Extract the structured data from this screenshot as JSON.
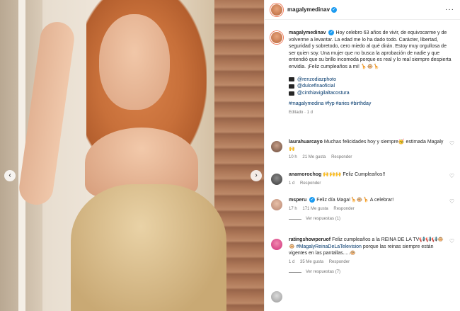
{
  "post": {
    "username": "magalymedinav",
    "caption": "Hoy celebro 63 años de vivir, de equivocarme y de volverme a levantar. La edad me lo ha dado todo. Carácter, libertad, seguridad y sobretodo, cero miedo al qué dirán. Estoy muy orgullosa de ser quien soy. Una mujer que no busca la aprobación de nadie y que entendió que su brillo incomoda porque es real y lo real siempre despierta envidia. ¡Feliz cumpleaños a mi! 🦒🐵🦒",
    "credits": [
      "@renzodiazphoto",
      "@dulcefinaoficial",
      "@cinthiavigilaltacostura"
    ],
    "hashtags": "#magalymedina #fyp #aries #birthday",
    "edited": "Editado · 1 d"
  },
  "comments": [
    {
      "username": "laurahuarcayo",
      "text": "Muchas felicidades hoy y siempre🥳 estimada Magaly🙌",
      "time": "10 h",
      "likes": "21 Me gusta",
      "reply": "Responder"
    },
    {
      "username": "anamorochog",
      "text": "🙌🙌🙌 Feliz Cumpleaños!!",
      "time": "1 d",
      "reply": "Responder"
    },
    {
      "username": "msperu",
      "text": "Feliz día Maga!🦒🐵🦒 A celebrar!",
      "time": "17 h",
      "likes": "171 Me gusta",
      "reply": "Responder",
      "view_replies": "Ver respuestas (1)"
    },
    {
      "username": "ratingshowperuof",
      "text_a": "Feliz cumpleaños a la REINA DE LA TV📢📢📢🐵🐵 ",
      "tag": "#MagalyReinaDeLaTelevision",
      "text_b": " porque las reinas siempre están vigentes en las pantallas.....🐵",
      "time": "1 d",
      "likes": "35 Me gusta",
      "reply": "Responder",
      "view_replies": "Ver respuestas (7)"
    }
  ],
  "icons": {
    "verified": "✓",
    "more": "···",
    "heart": "♡",
    "prev": "‹",
    "next": "›",
    "camera": "camera-icon"
  }
}
